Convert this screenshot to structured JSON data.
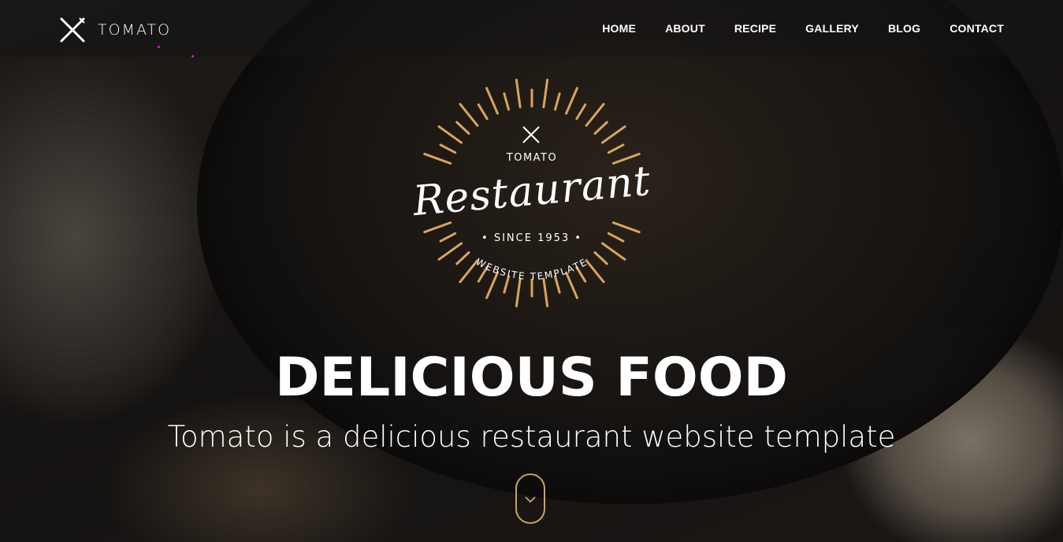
{
  "brand": {
    "name": "TOMATO",
    "logo_icon": "crossed-fork-knife-icon"
  },
  "nav": {
    "items": [
      "HOME",
      "ABOUT",
      "RECIPE",
      "GALLERY",
      "BLOG",
      "CONTACT"
    ]
  },
  "badge": {
    "brand": "TOMATO",
    "title": "Restaurant",
    "since": "• SINCE 1953 •",
    "tagline": "WEBSITE TEMPLATE",
    "accent_color": "#d9a55a"
  },
  "hero": {
    "headline": "DELICIOUS FOOD",
    "subline": "Tomato is a delicious restaurant website template",
    "scroll_icon": "chevron-down-icon"
  },
  "colors": {
    "accent": "#c9a264",
    "nav_text": "#ffffff"
  }
}
